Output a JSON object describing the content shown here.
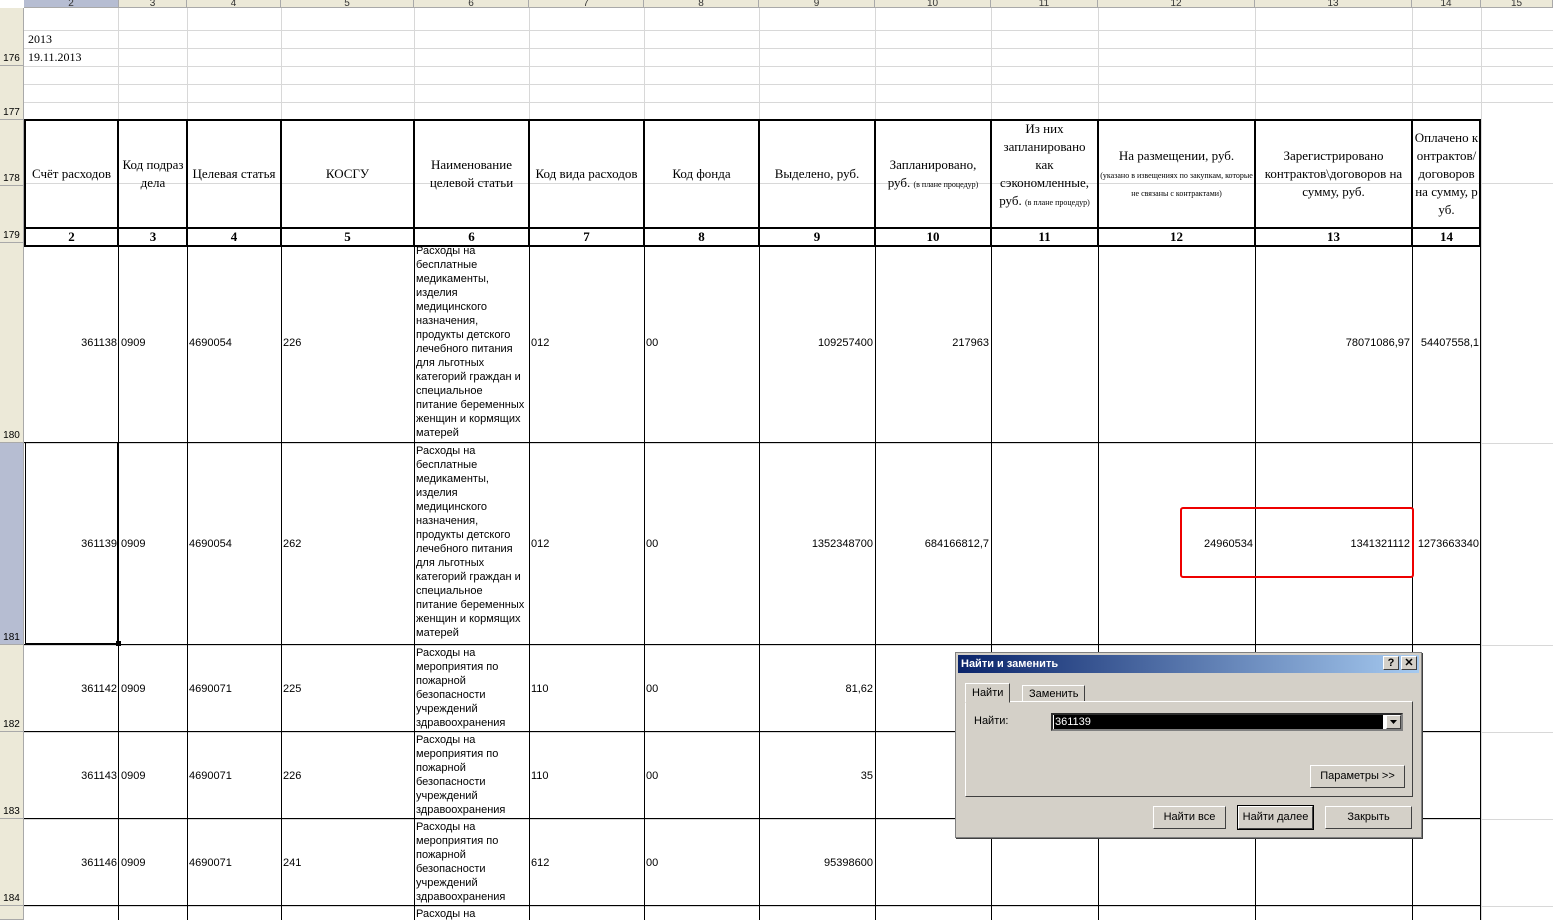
{
  "column_headers": [
    "2",
    "3",
    "4",
    "5",
    "6",
    "7",
    "8",
    "9",
    "10",
    "11",
    "12",
    "13",
    "14",
    "15"
  ],
  "top_rows": {
    "year": "2013",
    "date": "19.11.2013"
  },
  "row_numbers": {
    "r176": "176",
    "r177": "177",
    "r178": "178",
    "r179": "179",
    "r180": "180",
    "r181": "181",
    "r182": "182",
    "r183": "183",
    "r184": "184"
  },
  "header": {
    "c2": "Счёт расходов",
    "c3": "Код подраздела",
    "c4": "Целевая статья",
    "c5": "КОСГУ",
    "c6": "Наименование целевой статьи",
    "c7": "Код вида расходов",
    "c8": "Код фонда",
    "c9": "Выделено, руб.",
    "c10": "Запланировано, руб.",
    "c10_note": "(в плане процедур)",
    "c11": "Из них запланировано как сэкономленные, руб.",
    "c11_note": "(в плане процедур)",
    "c12": "На размещении, руб.",
    "c12_note": "(указано в извещениях по закупкам, которые не связаны с контрактами)",
    "c13": "Зарегистрировано контрактов\\договоров на сумму, руб.",
    "c14": "Оплачено контрактов/договоров на сумму, руб."
  },
  "numbers_row": [
    "2",
    "3",
    "4",
    "5",
    "6",
    "7",
    "8",
    "9",
    "10",
    "11",
    "12",
    "13",
    "14"
  ],
  "rows": [
    {
      "c2": "361138",
      "c3": "0909",
      "c4": "4690054",
      "c5": "226",
      "c6": "Расходы на бесплатные медикаменты, изделия медицинского назначения, продукты детского лечебного питания для льготных категорий граждан и специальное питание беременных женщин и кормящих матерей",
      "c7": "012",
      "c8": "00",
      "c9": "109257400",
      "c10": "217963",
      "c11": "",
      "c12": "",
      "c13": "78071086,97",
      "c14": "54407558,1"
    },
    {
      "c2": "361139",
      "c3": "0909",
      "c4": "4690054",
      "c5": "262",
      "c6": "Расходы на бесплатные медикаменты, изделия медицинского назначения, продукты детского лечебного питания для льготных категорий граждан и специальное питание беременных женщин и кормящих матерей",
      "c7": "012",
      "c8": "00",
      "c9": "1352348700",
      "c10": "684166812,7",
      "c11": "",
      "c12": "24960534",
      "c13": "1341321112",
      "c14": "1273663340"
    },
    {
      "c2": "361142",
      "c3": "0909",
      "c4": "4690071",
      "c5": "225",
      "c6": "Расходы на мероприятия по пожарной безопасности учреждений здравоохранения",
      "c7": "110",
      "c8": "00",
      "c9": "81,62",
      "c10": "",
      "c11": "",
      "c12": "",
      "c13": "",
      "c14": ""
    },
    {
      "c2": "361143",
      "c3": "0909",
      "c4": "4690071",
      "c5": "226",
      "c6": "Расходы на мероприятия по пожарной безопасности учреждений здравоохранения",
      "c7": "110",
      "c8": "00",
      "c9": "35",
      "c10": "",
      "c11": "",
      "c12": "",
      "c13": "",
      "c14": ""
    },
    {
      "c2": "361146",
      "c3": "0909",
      "c4": "4690071",
      "c5": "241",
      "c6": "Расходы на мероприятия по пожарной безопасности учреждений здравоохранения",
      "c7": "612",
      "c8": "00",
      "c9": "95398600",
      "c10": "",
      "c11": "",
      "c12": "",
      "c13": "",
      "c14": ""
    }
  ],
  "partial_row_text": "Расходы на",
  "dialog": {
    "title": "Найти и заменить",
    "help": "?",
    "close": "✕",
    "tab_find": "Найти",
    "tab_replace": "Заменить",
    "find_label": "Найти:",
    "find_value": "361139",
    "params_button": "Параметры >>",
    "find_all_button": "Найти все",
    "find_next_button": "Найти далее",
    "close_button": "Закрыть"
  },
  "colors": {
    "highlight": "#e00000",
    "title_start": "#0a246a",
    "title_end": "#a6caf0",
    "dialog_bg": "#d4d0c8",
    "row_header_selected": "#b6bdd2"
  }
}
